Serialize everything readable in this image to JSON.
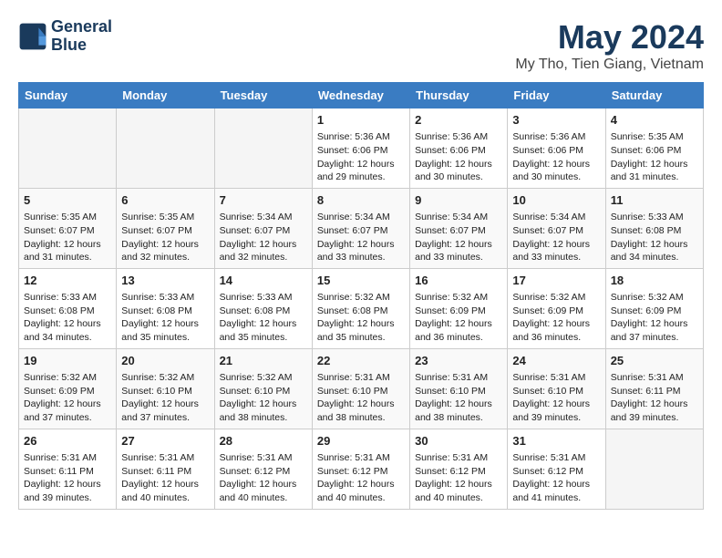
{
  "header": {
    "logo_line1": "General",
    "logo_line2": "Blue",
    "title": "May 2024",
    "subtitle": "My Tho, Tien Giang, Vietnam"
  },
  "weekdays": [
    "Sunday",
    "Monday",
    "Tuesday",
    "Wednesday",
    "Thursday",
    "Friday",
    "Saturday"
  ],
  "weeks": [
    [
      {
        "day": "",
        "info": ""
      },
      {
        "day": "",
        "info": ""
      },
      {
        "day": "",
        "info": ""
      },
      {
        "day": "1",
        "info": "Sunrise: 5:36 AM\nSunset: 6:06 PM\nDaylight: 12 hours and 29 minutes."
      },
      {
        "day": "2",
        "info": "Sunrise: 5:36 AM\nSunset: 6:06 PM\nDaylight: 12 hours and 30 minutes."
      },
      {
        "day": "3",
        "info": "Sunrise: 5:36 AM\nSunset: 6:06 PM\nDaylight: 12 hours and 30 minutes."
      },
      {
        "day": "4",
        "info": "Sunrise: 5:35 AM\nSunset: 6:06 PM\nDaylight: 12 hours and 31 minutes."
      }
    ],
    [
      {
        "day": "5",
        "info": "Sunrise: 5:35 AM\nSunset: 6:07 PM\nDaylight: 12 hours and 31 minutes."
      },
      {
        "day": "6",
        "info": "Sunrise: 5:35 AM\nSunset: 6:07 PM\nDaylight: 12 hours and 32 minutes."
      },
      {
        "day": "7",
        "info": "Sunrise: 5:34 AM\nSunset: 6:07 PM\nDaylight: 12 hours and 32 minutes."
      },
      {
        "day": "8",
        "info": "Sunrise: 5:34 AM\nSunset: 6:07 PM\nDaylight: 12 hours and 33 minutes."
      },
      {
        "day": "9",
        "info": "Sunrise: 5:34 AM\nSunset: 6:07 PM\nDaylight: 12 hours and 33 minutes."
      },
      {
        "day": "10",
        "info": "Sunrise: 5:34 AM\nSunset: 6:07 PM\nDaylight: 12 hours and 33 minutes."
      },
      {
        "day": "11",
        "info": "Sunrise: 5:33 AM\nSunset: 6:08 PM\nDaylight: 12 hours and 34 minutes."
      }
    ],
    [
      {
        "day": "12",
        "info": "Sunrise: 5:33 AM\nSunset: 6:08 PM\nDaylight: 12 hours and 34 minutes."
      },
      {
        "day": "13",
        "info": "Sunrise: 5:33 AM\nSunset: 6:08 PM\nDaylight: 12 hours and 35 minutes."
      },
      {
        "day": "14",
        "info": "Sunrise: 5:33 AM\nSunset: 6:08 PM\nDaylight: 12 hours and 35 minutes."
      },
      {
        "day": "15",
        "info": "Sunrise: 5:32 AM\nSunset: 6:08 PM\nDaylight: 12 hours and 35 minutes."
      },
      {
        "day": "16",
        "info": "Sunrise: 5:32 AM\nSunset: 6:09 PM\nDaylight: 12 hours and 36 minutes."
      },
      {
        "day": "17",
        "info": "Sunrise: 5:32 AM\nSunset: 6:09 PM\nDaylight: 12 hours and 36 minutes."
      },
      {
        "day": "18",
        "info": "Sunrise: 5:32 AM\nSunset: 6:09 PM\nDaylight: 12 hours and 37 minutes."
      }
    ],
    [
      {
        "day": "19",
        "info": "Sunrise: 5:32 AM\nSunset: 6:09 PM\nDaylight: 12 hours and 37 minutes."
      },
      {
        "day": "20",
        "info": "Sunrise: 5:32 AM\nSunset: 6:10 PM\nDaylight: 12 hours and 37 minutes."
      },
      {
        "day": "21",
        "info": "Sunrise: 5:32 AM\nSunset: 6:10 PM\nDaylight: 12 hours and 38 minutes."
      },
      {
        "day": "22",
        "info": "Sunrise: 5:31 AM\nSunset: 6:10 PM\nDaylight: 12 hours and 38 minutes."
      },
      {
        "day": "23",
        "info": "Sunrise: 5:31 AM\nSunset: 6:10 PM\nDaylight: 12 hours and 38 minutes."
      },
      {
        "day": "24",
        "info": "Sunrise: 5:31 AM\nSunset: 6:10 PM\nDaylight: 12 hours and 39 minutes."
      },
      {
        "day": "25",
        "info": "Sunrise: 5:31 AM\nSunset: 6:11 PM\nDaylight: 12 hours and 39 minutes."
      }
    ],
    [
      {
        "day": "26",
        "info": "Sunrise: 5:31 AM\nSunset: 6:11 PM\nDaylight: 12 hours and 39 minutes."
      },
      {
        "day": "27",
        "info": "Sunrise: 5:31 AM\nSunset: 6:11 PM\nDaylight: 12 hours and 40 minutes."
      },
      {
        "day": "28",
        "info": "Sunrise: 5:31 AM\nSunset: 6:12 PM\nDaylight: 12 hours and 40 minutes."
      },
      {
        "day": "29",
        "info": "Sunrise: 5:31 AM\nSunset: 6:12 PM\nDaylight: 12 hours and 40 minutes."
      },
      {
        "day": "30",
        "info": "Sunrise: 5:31 AM\nSunset: 6:12 PM\nDaylight: 12 hours and 40 minutes."
      },
      {
        "day": "31",
        "info": "Sunrise: 5:31 AM\nSunset: 6:12 PM\nDaylight: 12 hours and 41 minutes."
      },
      {
        "day": "",
        "info": ""
      }
    ]
  ]
}
